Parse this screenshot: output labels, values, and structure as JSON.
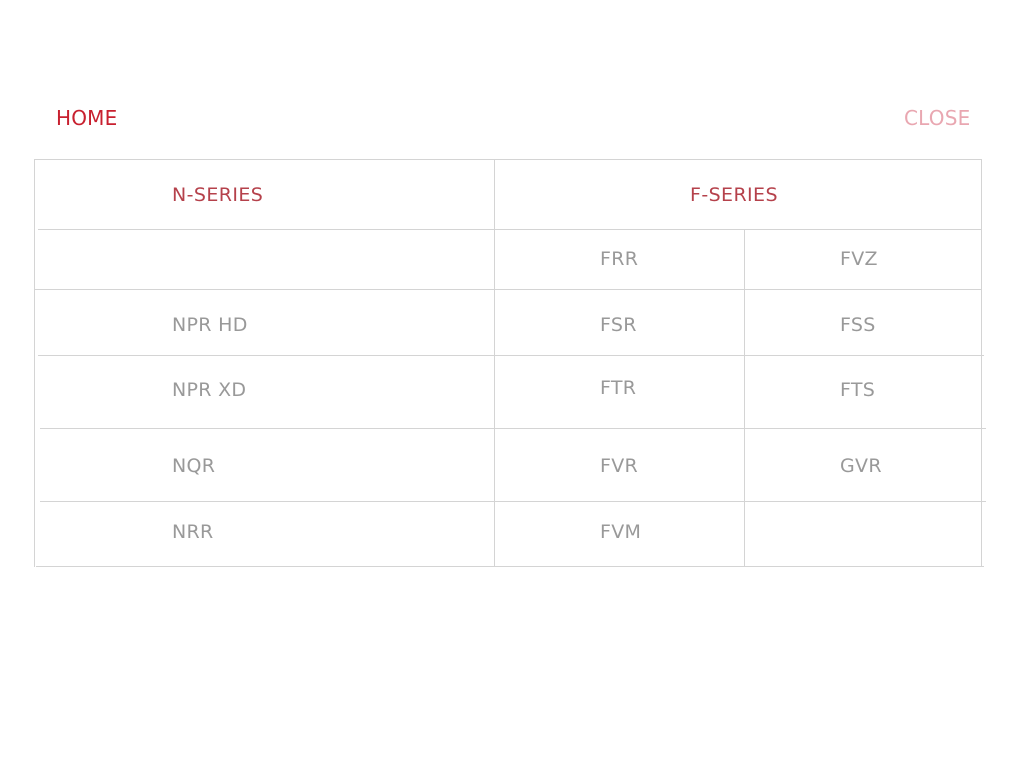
{
  "nav": {
    "home_label": "HOME",
    "close_label": "CLOSE"
  },
  "table": {
    "headers": {
      "n_series": "N-SERIES",
      "f_series": "F-SERIES"
    },
    "n_series": [
      "NPR HD",
      "NPR XD",
      "NQR",
      "NRR"
    ],
    "f_series_col1": [
      "FRR",
      "FSR",
      "FTR",
      "FVR",
      "FVM"
    ],
    "f_series_col2": [
      "FVZ",
      "FSS",
      "FTS",
      "GVR"
    ]
  },
  "colors": {
    "home": "#c8202f",
    "close": "#e9a7b1",
    "header": "#b5414b",
    "cell_text": "#999999",
    "grid_line": "#d4d4d4"
  }
}
